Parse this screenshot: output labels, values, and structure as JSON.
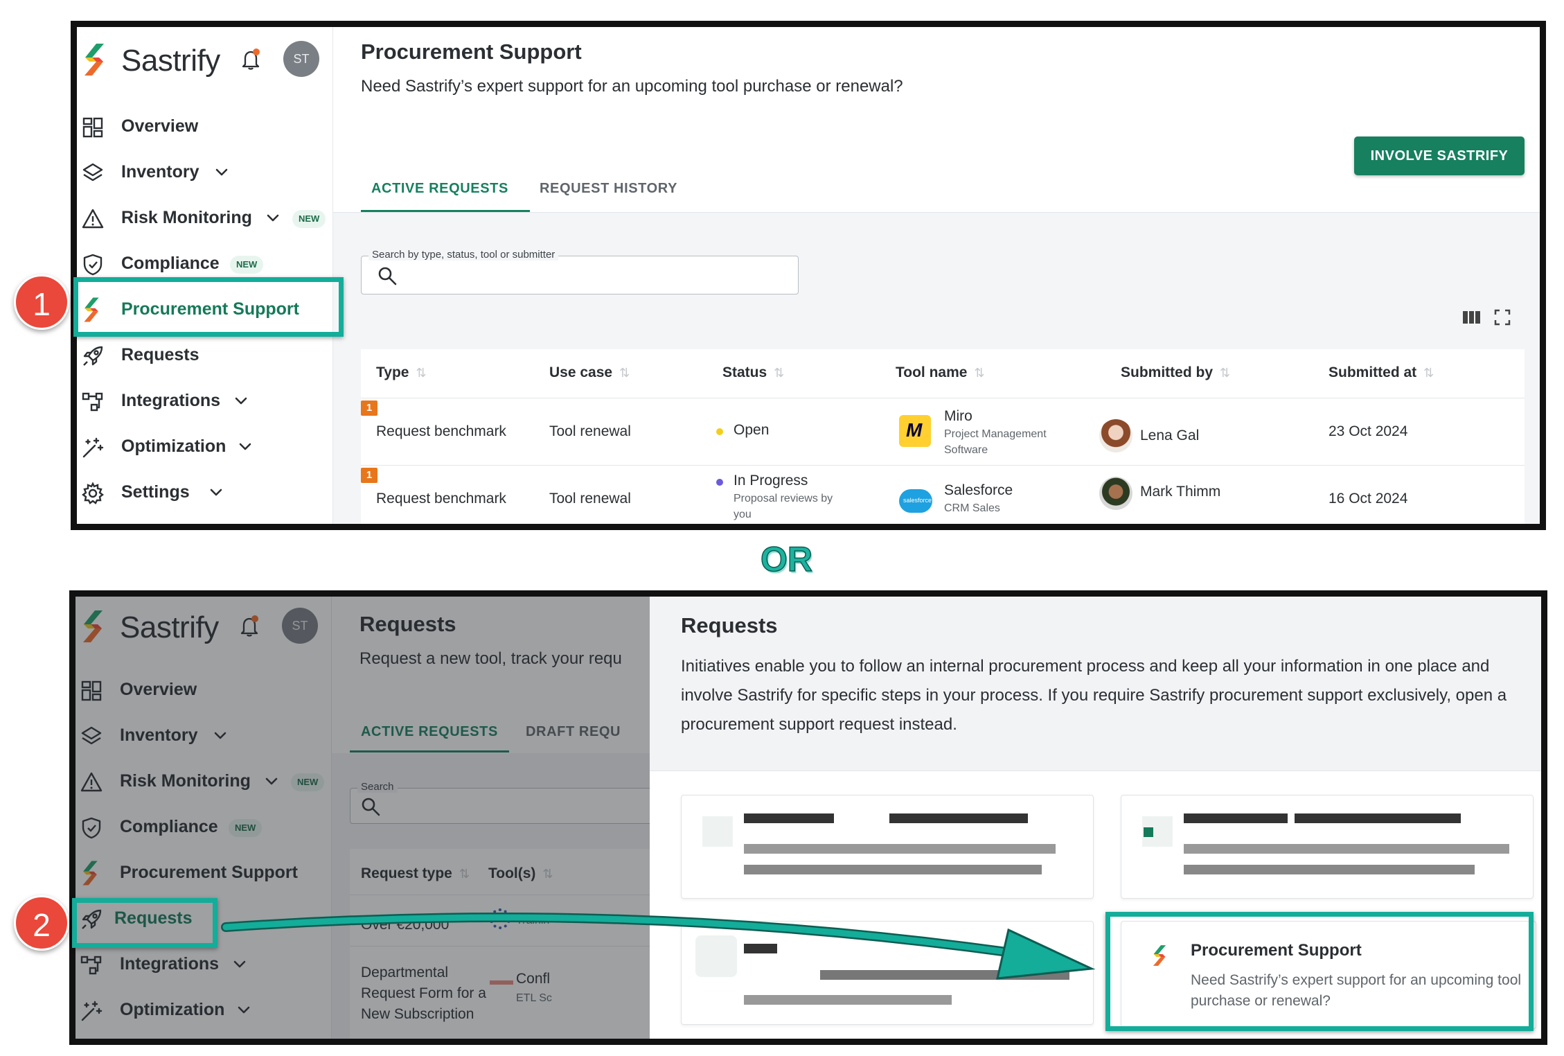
{
  "brand": "Sastrify",
  "avatar_initials": "ST",
  "sidebar": {
    "items": [
      {
        "label": "Overview",
        "icon": "grid-icon"
      },
      {
        "label": "Inventory",
        "icon": "layers-icon"
      },
      {
        "label": "Risk Monitoring",
        "icon": "warning-icon",
        "badge": "NEW"
      },
      {
        "label": "Compliance",
        "icon": "shield-icon",
        "badge": "NEW"
      },
      {
        "label": "Procurement Support",
        "icon": "sastrify-logo-icon"
      },
      {
        "label": "Requests",
        "icon": "rocket-icon"
      },
      {
        "label": "Integrations",
        "icon": "integrations-icon"
      },
      {
        "label": "Optimization",
        "icon": "sparkle-icon"
      },
      {
        "label": "Settings",
        "icon": "gear-icon"
      }
    ]
  },
  "top": {
    "title": "Procurement Support",
    "subtitle": "Need Sastrify’s expert support for an upcoming tool purchase or renewal?",
    "button": "INVOLVE SASTRIFY",
    "tabs": [
      "ACTIVE REQUESTS",
      "REQUEST HISTORY"
    ],
    "search_legend": "Search by type, status, tool or submitter",
    "columns": [
      "Type",
      "Use case",
      "Status",
      "Tool name",
      "Submitted by",
      "Submitted at"
    ],
    "rows": [
      {
        "rank": "1",
        "type": "Request benchmark",
        "use_case": "Tool renewal",
        "status": "Open",
        "status_color": "#f2cf1d",
        "status_sub": "",
        "tool": "Miro",
        "tool_sub": "Project Management Software",
        "submitter": "Lena Gal",
        "date": "23 Oct 2024"
      },
      {
        "rank": "1",
        "type": "Request benchmark",
        "use_case": "Tool renewal",
        "status": "In Progress",
        "status_color": "#6b5bdc",
        "status_sub": "Proposal reviews by you",
        "tool": "Salesforce",
        "tool_sub": "CRM Sales",
        "submitter": "Mark Thimm",
        "date": "16 Oct 2024"
      }
    ]
  },
  "or_label": "OR",
  "bottom": {
    "title": "Requests",
    "subtitle": "Request a new tool, track your requ",
    "tabs": [
      "ACTIVE REQUESTS",
      "DRAFT REQU"
    ],
    "search_legend": "Search",
    "columns": [
      "Request type",
      "Tool(s)"
    ],
    "row1_text": "Over €20,000",
    "row1_tool_sub": "Trainin",
    "row2_text": "Departmental Request Form for a New Subscription",
    "row2_tool": "Confl",
    "row2_tool_sub": "ETL Sc",
    "modal_title": "Requests",
    "modal_text": "Initiatives enable you to follow an internal procurement process and keep all your information in one place and involve Sastrify for specific steps in your process. If you require Sastrify procurement support exclusively, open a procurement support request instead.",
    "card_title": "Procurement Support",
    "card_text": "Need Sastrify’s expert support for an upcoming tool purchase or renewal?"
  },
  "callouts": [
    "1",
    "2"
  ],
  "colors": {
    "accent": "#16805f",
    "highlight": "#13ad9a",
    "callout": "#e9483b"
  }
}
